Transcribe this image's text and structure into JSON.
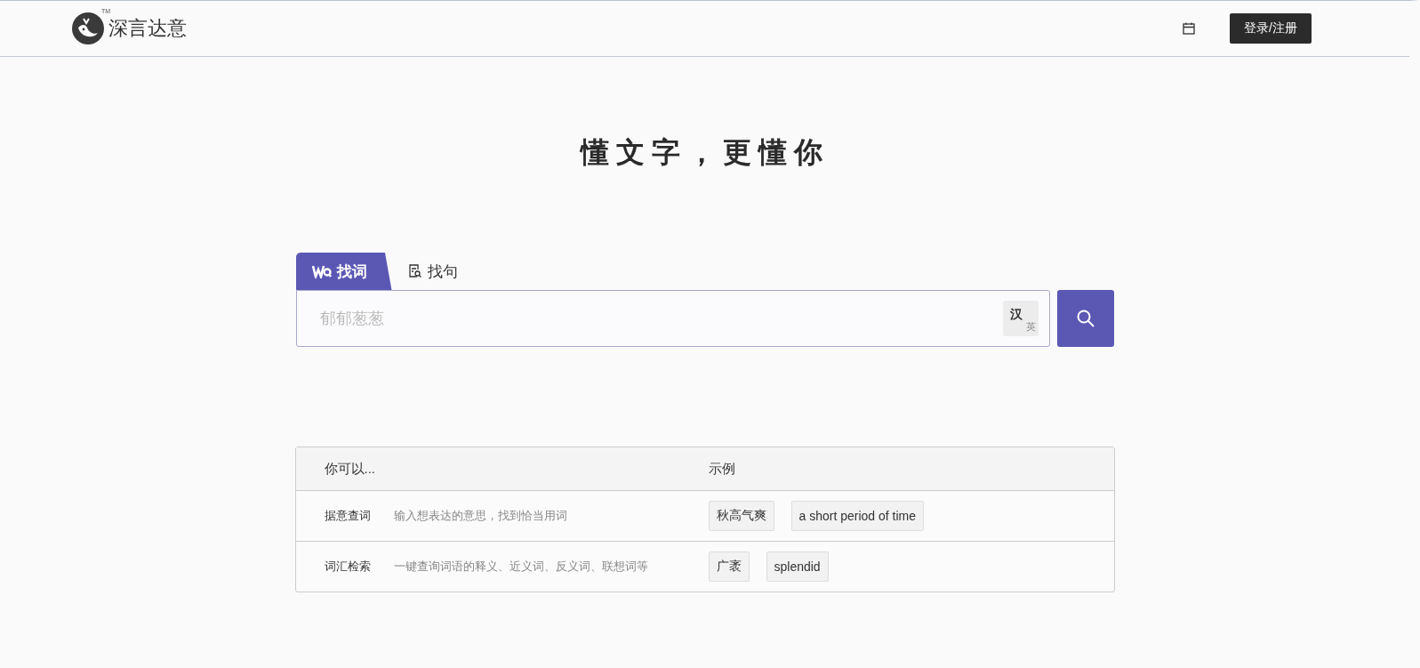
{
  "header": {
    "brand": "深言达意",
    "trademark": "TM",
    "login_button": "登录/注册"
  },
  "hero": {
    "slogan": "懂文字，更懂你"
  },
  "search": {
    "tabs": [
      {
        "label": "找词",
        "selected": true,
        "kind": "word"
      },
      {
        "label": "找句",
        "selected": false,
        "kind": "sentence"
      }
    ],
    "placeholder": "郁郁葱葱",
    "lang_toggle": {
      "primary": "汉",
      "secondary": "英"
    }
  },
  "table": {
    "columns": [
      "你可以...",
      "示例"
    ],
    "rows": [
      {
        "feature": "据意查词",
        "description": "输入想表达的意思，找到恰当用词",
        "examples": [
          "秋高气爽",
          "a short period of time"
        ]
      },
      {
        "feature": "词汇检索",
        "description": "一键查询词语的释义、近义词、反义词、联想词等",
        "examples": [
          "广袤",
          "splendid"
        ]
      }
    ]
  }
}
